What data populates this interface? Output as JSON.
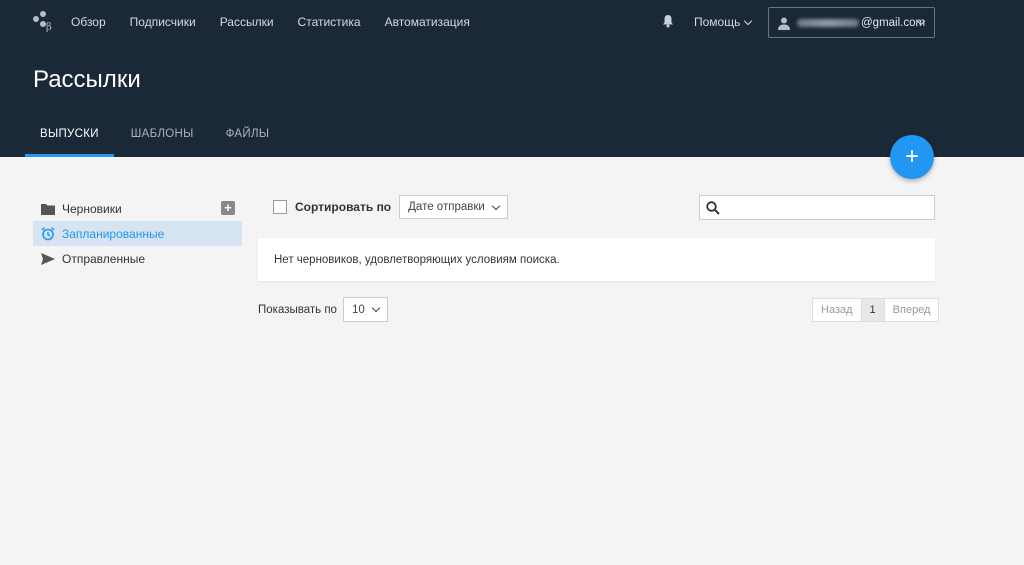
{
  "nav": {
    "links": [
      "Обзор",
      "Подписчики",
      "Рассылки",
      "Статистика",
      "Автоматизация"
    ],
    "help_label": "Помощь",
    "account_email_suffix": "@gmail.com"
  },
  "page": {
    "title": "Рассылки",
    "tabs": [
      {
        "label": "ВЫПУСКИ",
        "active": true
      },
      {
        "label": "ШАБЛОНЫ",
        "active": false
      },
      {
        "label": "ФАЙЛЫ",
        "active": false
      }
    ],
    "fab_label": "+"
  },
  "sidebar": {
    "items": [
      {
        "label": "Черновики",
        "icon": "folder-icon",
        "active": false
      },
      {
        "label": "Запланированные",
        "icon": "alarm-clock-icon",
        "active": true
      },
      {
        "label": "Отправленные",
        "icon": "send-icon",
        "active": false
      }
    ],
    "add_label": "+"
  },
  "toolbar": {
    "sort_label": "Сортировать по",
    "sort_value": "Дате отправки",
    "search_placeholder": ""
  },
  "content": {
    "empty_message": "Нет черновиков, удовлетворяющих условиям поиска."
  },
  "pagination": {
    "per_page_label": "Показывать по",
    "per_page_value": "10",
    "prev_label": "Назад",
    "current_page": "1",
    "next_label": "Вперед"
  },
  "colors": {
    "header_bg": "#1b2838",
    "accent": "#2196f3",
    "active_item_bg": "#d6e4f2",
    "body_bg": "#f4f4f4"
  }
}
